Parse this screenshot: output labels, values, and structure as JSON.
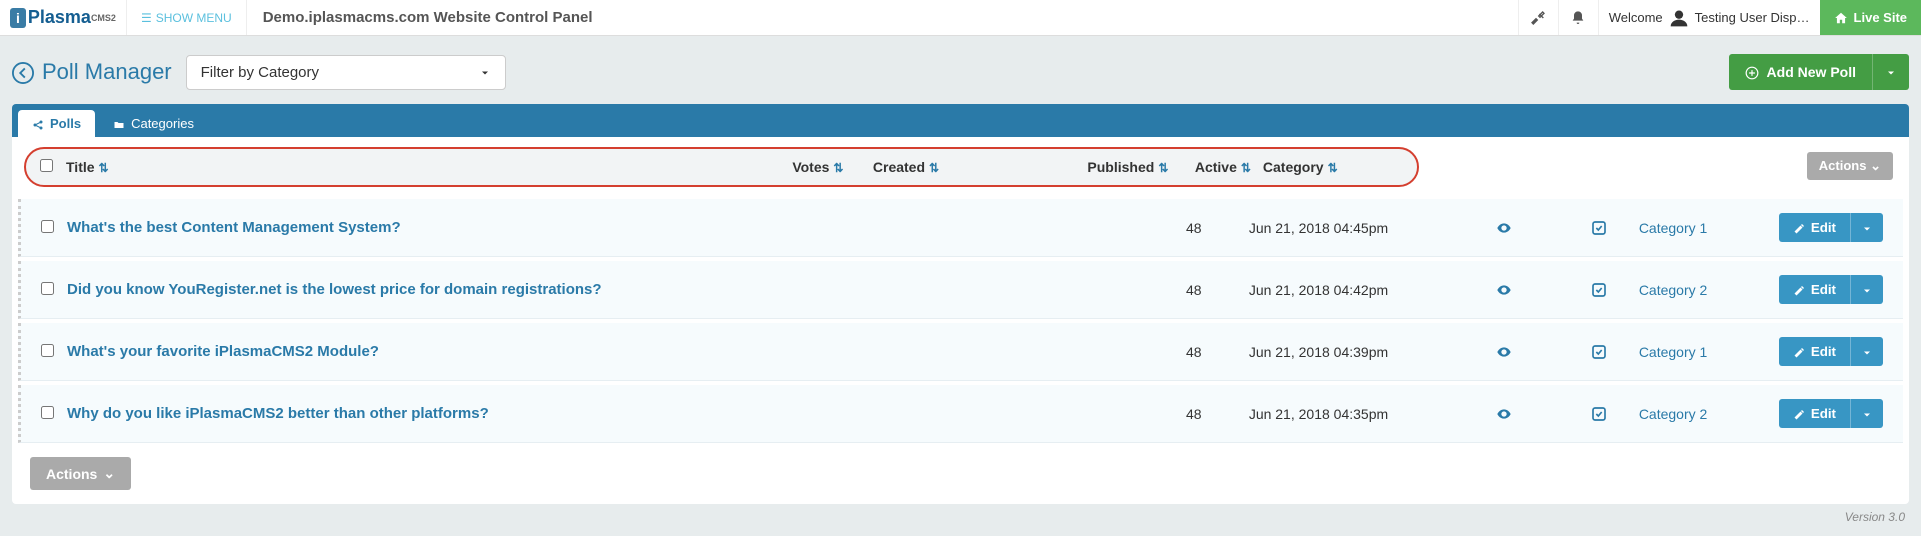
{
  "topbar": {
    "logo_main": "Plasma",
    "logo_sup": "CMS2",
    "show_menu": "SHOW MENU",
    "site_title": "Demo.iplasmacms.com Website Control Panel",
    "welcome_label": "Welcome",
    "username": "Testing User Disp…",
    "live_site": "Live Site"
  },
  "page": {
    "title": "Poll Manager",
    "filter_placeholder": "Filter by Category",
    "add_button": "Add New Poll"
  },
  "tabs": {
    "polls": "Polls",
    "categories": "Categories"
  },
  "columns": {
    "title": "Title",
    "votes": "Votes",
    "created": "Created",
    "published": "Published",
    "active": "Active",
    "category": "Category",
    "actions": "Actions"
  },
  "rows": [
    {
      "title": "What's the best Content Management System?",
      "votes": "48",
      "created": "Jun 21, 2018 04:45pm",
      "category": "Category 1"
    },
    {
      "title": "Did you know YouRegister.net is the lowest price for domain registrations?",
      "votes": "48",
      "created": "Jun 21, 2018 04:42pm",
      "category": "Category 2"
    },
    {
      "title": "What's your favorite iPlasmaCMS2 Module?",
      "votes": "48",
      "created": "Jun 21, 2018 04:39pm",
      "category": "Category 1"
    },
    {
      "title": "Why do you like iPlasmaCMS2 better than other platforms?",
      "votes": "48",
      "created": "Jun 21, 2018 04:35pm",
      "category": "Category 2"
    }
  ],
  "buttons": {
    "edit": "Edit",
    "actions": "Actions"
  },
  "footer": {
    "version": "Version 3.0"
  }
}
